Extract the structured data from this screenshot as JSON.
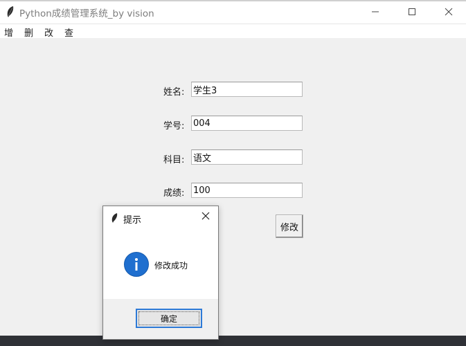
{
  "window": {
    "title": "Python成绩管理系统_by vision",
    "icon": "feather-icon",
    "controls": [
      "minimize-icon",
      "maximize-icon",
      "close-icon"
    ]
  },
  "menu": {
    "items": [
      {
        "label": "增"
      },
      {
        "label": "删"
      },
      {
        "label": "改"
      },
      {
        "label": "查"
      }
    ]
  },
  "form": {
    "name": {
      "label": "姓名:",
      "value": "学生3"
    },
    "id": {
      "label": "学号:",
      "value": "004"
    },
    "subject": {
      "label": "科目:",
      "value": "语文"
    },
    "score": {
      "label": "成绩:",
      "value": "100"
    },
    "modify_button": "修改"
  },
  "dialog": {
    "title": "提示",
    "message": "修改成功",
    "icon": "info-icon",
    "ok_button": "确定"
  },
  "colors": {
    "accent": "#2d7ad7",
    "info": "#1f6fcf",
    "background": "#f0f0f0"
  }
}
